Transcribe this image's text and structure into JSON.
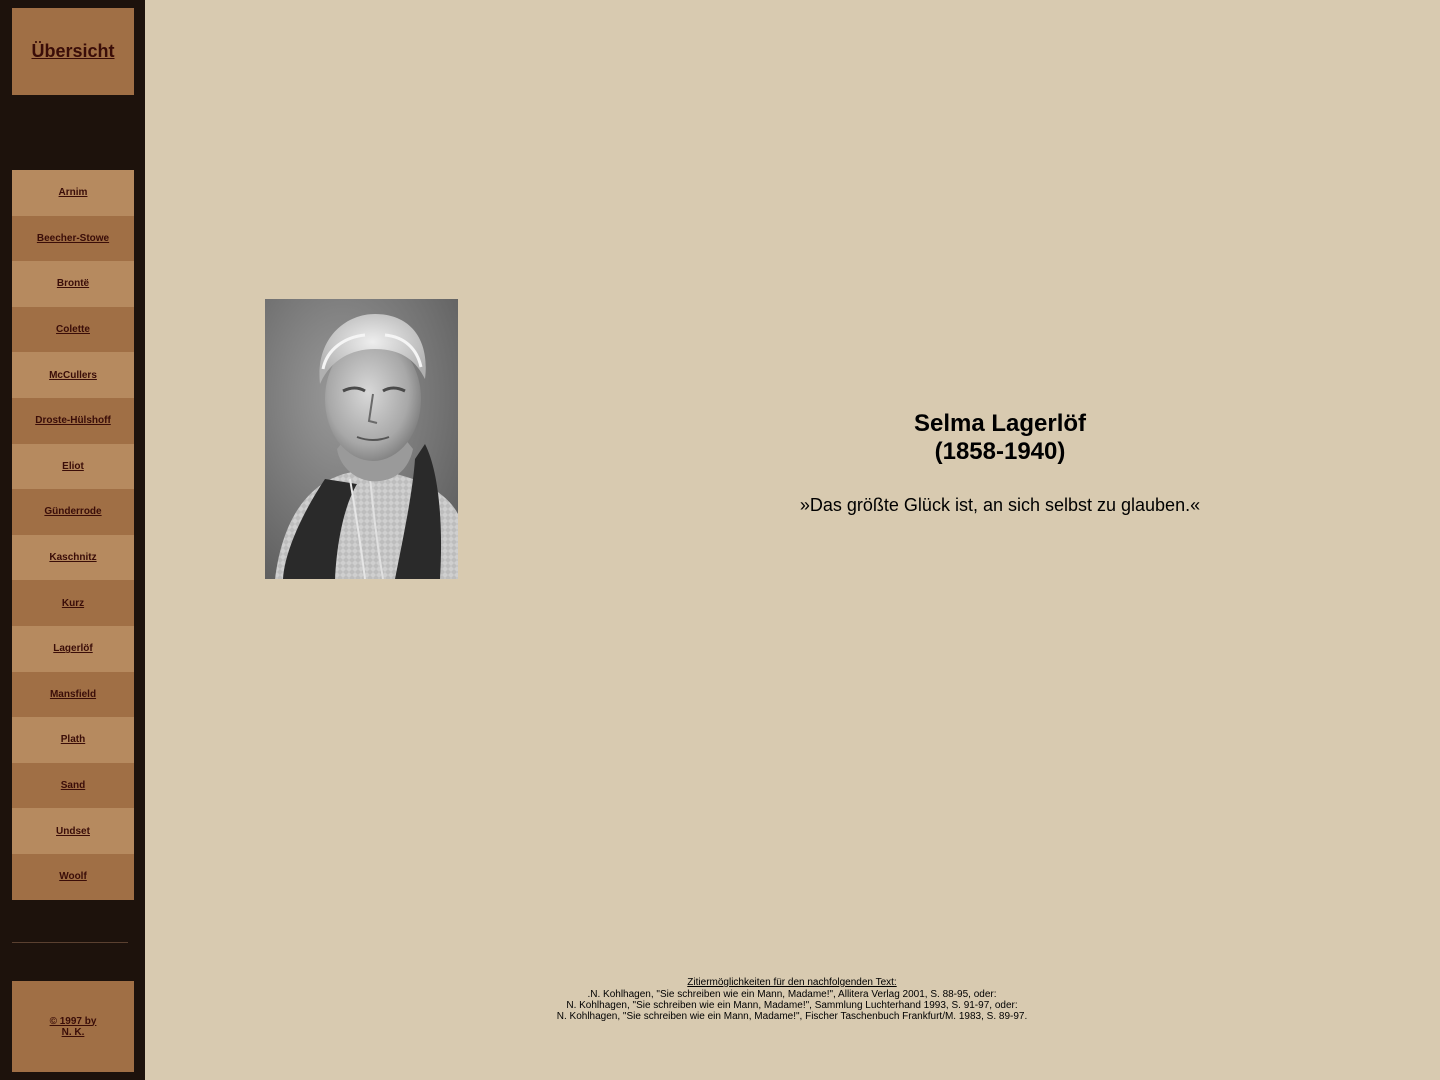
{
  "sidebar": {
    "overview_label": "Übersicht",
    "items": [
      {
        "label": "Arnim"
      },
      {
        "label": "Beecher-Stowe"
      },
      {
        "label": "Brontë"
      },
      {
        "label": "Colette"
      },
      {
        "label": "McCullers"
      },
      {
        "label": "Droste-Hülshoff"
      },
      {
        "label": "Eliot"
      },
      {
        "label": "Günderrode"
      },
      {
        "label": "Kaschnitz"
      },
      {
        "label": "Kurz"
      },
      {
        "label": "Lagerlöf"
      },
      {
        "label": "Mansfield"
      },
      {
        "label": "Plath"
      },
      {
        "label": "Sand"
      },
      {
        "label": "Undset"
      },
      {
        "label": "Woolf"
      }
    ],
    "copyright_line1": "© 1997 by",
    "copyright_line2": "N. K."
  },
  "main": {
    "author_name": "Selma Lagerlöf",
    "author_dates": "(1858-1940)",
    "quote": "»Das größte Glück ist, an sich selbst zu glauben.«",
    "citation_heading": "Zitiermöglichkeiten für den nachfolgenden Text:",
    "citations": [
      ".N. Kohlhagen, \"Sie schreiben wie ein Mann, Madame!\", Allitera Verlag 2001, S. 88-95, oder:",
      "N. Kohlhagen, \"Sie schreiben wie ein Mann, Madame!\", Sammlung Luchterhand 1993, S. 91-97, oder:",
      "N. Kohlhagen, \"Sie schreiben wie ein Mann, Madame!\", Fischer Taschenbuch Frankfurt/M. 1983, S. 89-97."
    ]
  },
  "colors": {
    "page_background": "#d8cab0",
    "sidebar_background": "#1d120c",
    "nav_light": "#b68a5f",
    "nav_dark": "#a06f45",
    "link_color": "#3a0d08"
  },
  "icons": {
    "portrait": "portrait-photo"
  }
}
